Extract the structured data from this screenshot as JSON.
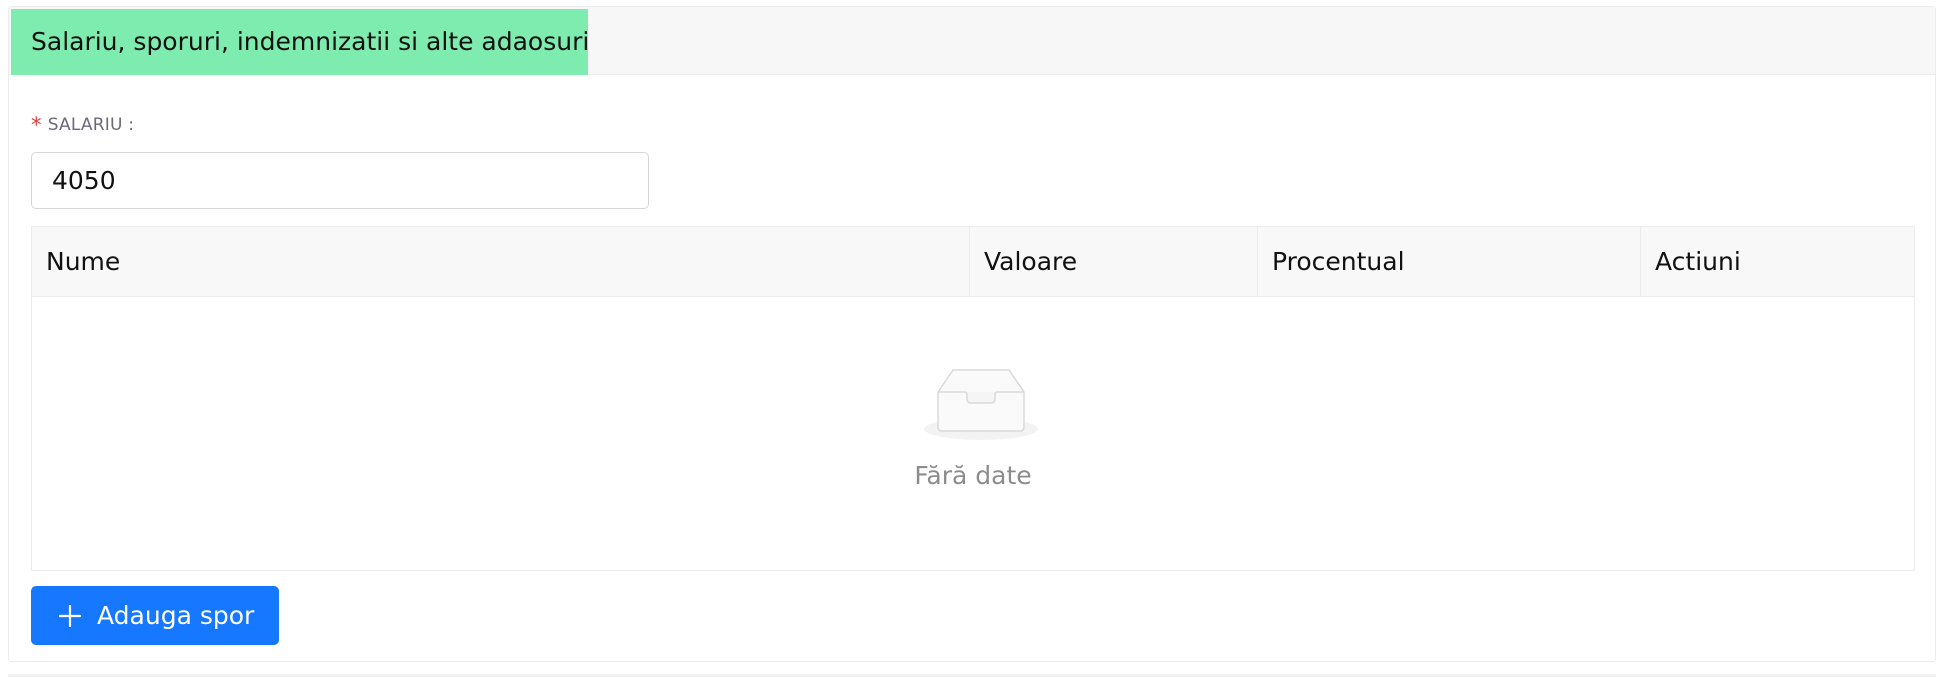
{
  "section": {
    "title": "Salariu, sporuri, indemnizatii si alte adaosuri",
    "title_bg_color": "#7eebaf"
  },
  "salary_field": {
    "required_marker": "*",
    "label": "SALARIU :",
    "value": "4050"
  },
  "table": {
    "columns": [
      "Nume",
      "Valoare",
      "Procentual",
      "Actiuni"
    ],
    "rows": [],
    "empty_icon": "inbox-icon",
    "empty_text": "Fără date"
  },
  "add_button": {
    "icon": "plus-icon",
    "label": "Adauga spor",
    "color": "#1677ff"
  }
}
